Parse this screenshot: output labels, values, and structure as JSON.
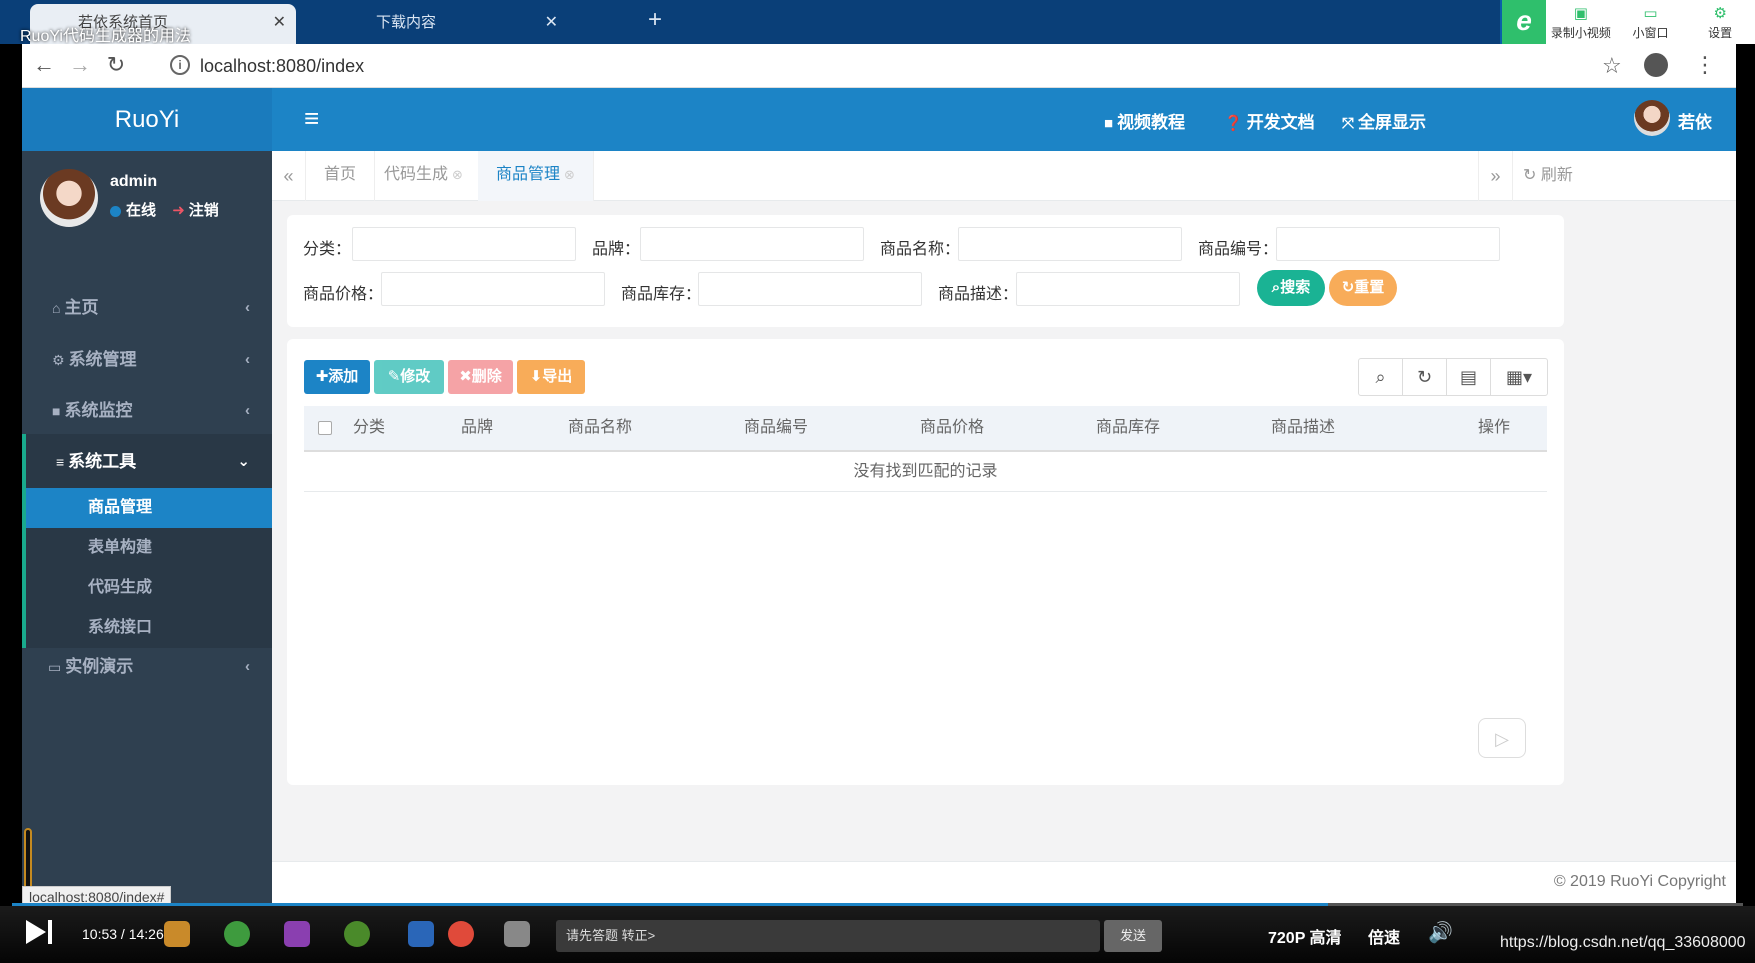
{
  "browser": {
    "tabs": [
      {
        "label": "若依系统首页",
        "active": true
      },
      {
        "label": "下载内容",
        "active": false
      }
    ],
    "new_tab": "+",
    "url": "localhost:8080/index",
    "status_url": "localhost:8080/index#"
  },
  "video": {
    "title": "RuoYi代码生成器的用法",
    "tools": [
      {
        "label": "录制小视频",
        "icon": "record-video-icon"
      },
      {
        "label": "小窗口",
        "icon": "mini-window-icon"
      },
      {
        "label": "设置",
        "icon": "settings-icon"
      }
    ],
    "time": "10:53 / 14:26",
    "progress": 0.76,
    "danmaku_placeholder": "请先答题 转正>",
    "send_label": "发送",
    "quality": "720P 高清",
    "speed": "倍速",
    "watermark": "https://blog.csdn.net/qq_33608000"
  },
  "header": {
    "brand": "RuoYi",
    "links": [
      {
        "label": "视频教程",
        "icon": "video-camera-icon"
      },
      {
        "label": "开发文档",
        "icon": "question-circle-icon"
      },
      {
        "label": "全屏显示",
        "icon": "fullscreen-icon"
      }
    ],
    "user": "若依"
  },
  "sidebar": {
    "user_name": "admin",
    "status_online": "在线",
    "logout": "注销",
    "items": [
      {
        "label": "主页",
        "icon": "home-icon"
      },
      {
        "label": "系统管理",
        "icon": "gear-icon"
      },
      {
        "label": "系统监控",
        "icon": "video-icon"
      },
      {
        "label": "系统工具",
        "icon": "bars-icon",
        "open": true
      },
      {
        "label": "实例演示",
        "icon": "desktop-icon"
      }
    ],
    "submenu": [
      "商品管理",
      "表单构建",
      "代码生成",
      "系统接口"
    ]
  },
  "content_tabs": {
    "tabs": [
      "首页",
      "代码生成",
      "商品管理"
    ],
    "refresh": "刷新"
  },
  "search": {
    "fields": [
      "分类：",
      "品牌：",
      "商品名称：",
      "商品编号：",
      "商品价格：",
      "商品库存：",
      "商品描述："
    ],
    "search_btn": "搜索",
    "reset_btn": "重置"
  },
  "toolbar": {
    "add": "添加",
    "edit": "修改",
    "delete": "删除",
    "export": "导出"
  },
  "table": {
    "columns": [
      "分类",
      "品牌",
      "商品名称",
      "商品编号",
      "商品价格",
      "商品库存",
      "商品描述",
      "操作"
    ],
    "empty_text": "没有找到匹配的记录"
  },
  "footer": {
    "copyright": "© 2019 RuoYi Copyright"
  },
  "colors": {
    "primary": "#1c84c6",
    "sidebar": "#2f4050",
    "success": "#1ab394",
    "warning": "#f8ac59"
  }
}
